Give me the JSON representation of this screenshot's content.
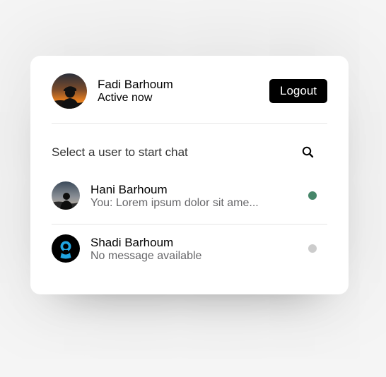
{
  "current_user": {
    "name": "Fadi Barhoum",
    "status": "Active now",
    "avatar_icon": "sunset-silhouette-photo"
  },
  "header": {
    "logout_label": "Logout"
  },
  "search": {
    "title": "Select a user to start chat",
    "icon": "search-icon"
  },
  "users": [
    {
      "name": "Hani Barhoum",
      "last_message": "You: Lorem ipsum dolor sit ame...",
      "status": "online",
      "status_color": "#468669",
      "avatar_icon": "silhouette-photo"
    },
    {
      "name": "Shadi Barhoum",
      "last_message": "No message available",
      "status": "offline",
      "status_color": "#cccccc",
      "avatar_icon": "default-user-icon"
    }
  ]
}
